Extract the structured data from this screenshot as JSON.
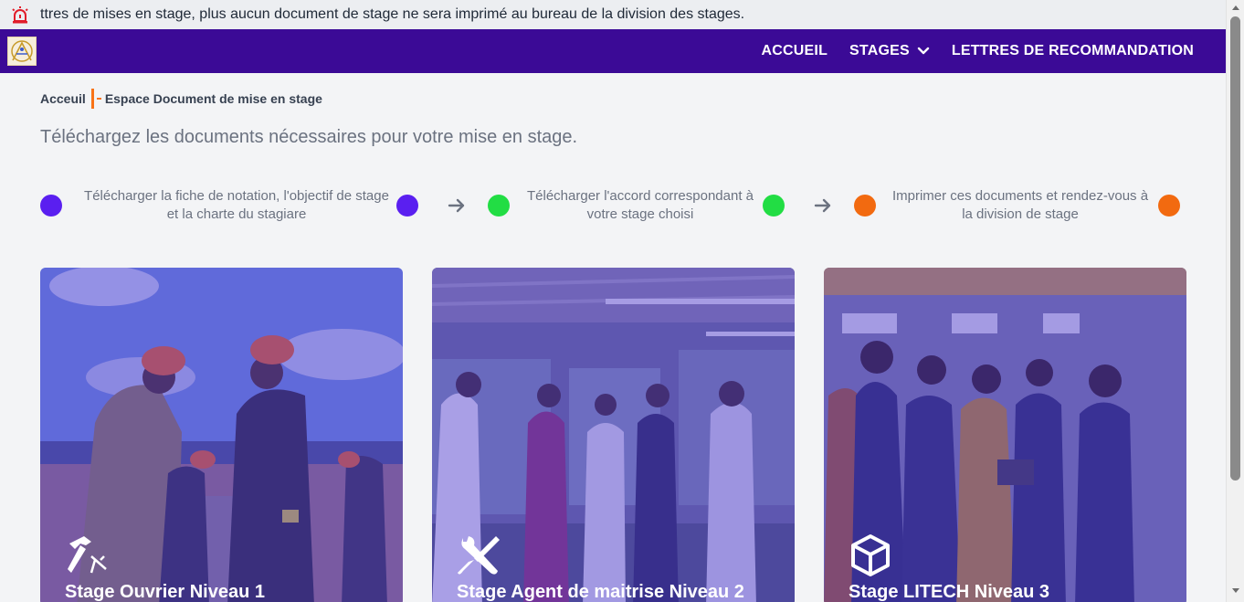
{
  "ticker": {
    "icon": "alarm-siren-icon",
    "text": "ttres de mises en stage, plus aucun document de stage ne sera imprimé au bureau de la division des stages."
  },
  "navbar": {
    "logo": "school-logo",
    "links": [
      {
        "label": "ACCUEIL"
      },
      {
        "label": "STAGES",
        "icon": "chevron-down-icon"
      },
      {
        "label": "LETTRES DE RECOMMANDATION"
      }
    ],
    "color": "#3b0a96"
  },
  "breadcrumb": {
    "home": "Acceuil",
    "current": "Espace Document de mise en stage"
  },
  "intro": "Téléchargez les documents nécessaires pour votre mise en stage.",
  "steps": [
    {
      "text": "Télécharger la fiche de notation, l'objectif de stage et la charte du stagiare",
      "color": "#5a1ff0"
    },
    {
      "text": "Télécharger l'accord correspondant à votre stage choisi",
      "color": "#22dd44"
    },
    {
      "text": "Imprimer ces documents et rendez-vous à la division de stage",
      "color": "#f26a10"
    }
  ],
  "cards": [
    {
      "title": "Stage Ouvrier Niveau 1",
      "icon": "hammer-icon"
    },
    {
      "title": "Stage Agent de maitrise Niveau 2",
      "icon": "wrench-screwdriver-icon"
    },
    {
      "title": "Stage LITECH Niveau 3",
      "icon": "cube-icon"
    }
  ]
}
